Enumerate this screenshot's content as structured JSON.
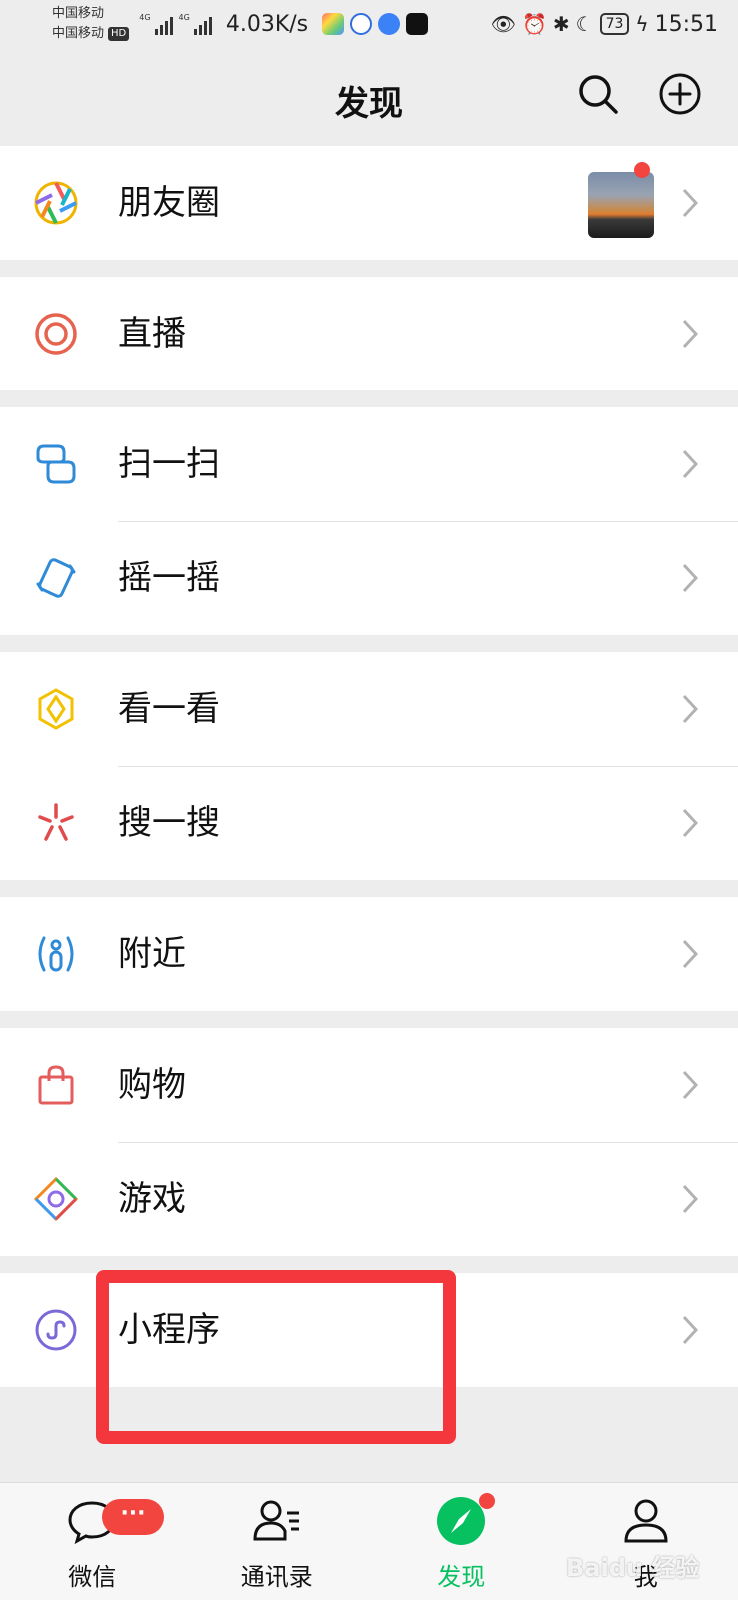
{
  "status_bar": {
    "carrier_1": "中国移动",
    "carrier_2": "中国移动",
    "hd": "HD",
    "network_1": "4G",
    "network_2": "4G",
    "net_speed": "4.03K/s",
    "battery": "73",
    "time": "15:51"
  },
  "header": {
    "title": "发现",
    "search_icon": "search-icon",
    "add_icon": "plus-circle-icon"
  },
  "menu": {
    "moments": {
      "label": "朋友圈",
      "icon": "moments-aperture-icon",
      "has_new": true
    },
    "live": {
      "label": "直播",
      "icon": "live-circle-icon"
    },
    "scan": {
      "label": "扫一扫",
      "icon": "scan-icon"
    },
    "shake": {
      "label": "摇一摇",
      "icon": "shake-icon"
    },
    "top_stories": {
      "label": "看一看",
      "icon": "top-stories-icon"
    },
    "search": {
      "label": "搜一搜",
      "icon": "search-spark-icon"
    },
    "nearby": {
      "label": "附近",
      "icon": "nearby-icon"
    },
    "shopping": {
      "label": "购物",
      "icon": "shopping-bag-icon"
    },
    "games": {
      "label": "游戏",
      "icon": "games-icon"
    },
    "mini_programs": {
      "label": "小程序",
      "icon": "mini-program-icon",
      "highlighted": true
    }
  },
  "tabbar": {
    "chats": {
      "label": "微信",
      "badge": "···"
    },
    "contacts": {
      "label": "通讯录"
    },
    "discover": {
      "label": "发现",
      "active": true,
      "has_new": true
    },
    "me": {
      "label": "我"
    }
  },
  "watermark": "Baidu 经验",
  "colors": {
    "accent_green": "#07c160",
    "badge_red": "#f3453f",
    "highlight_red": "#f4373c",
    "background": "#ededed"
  }
}
